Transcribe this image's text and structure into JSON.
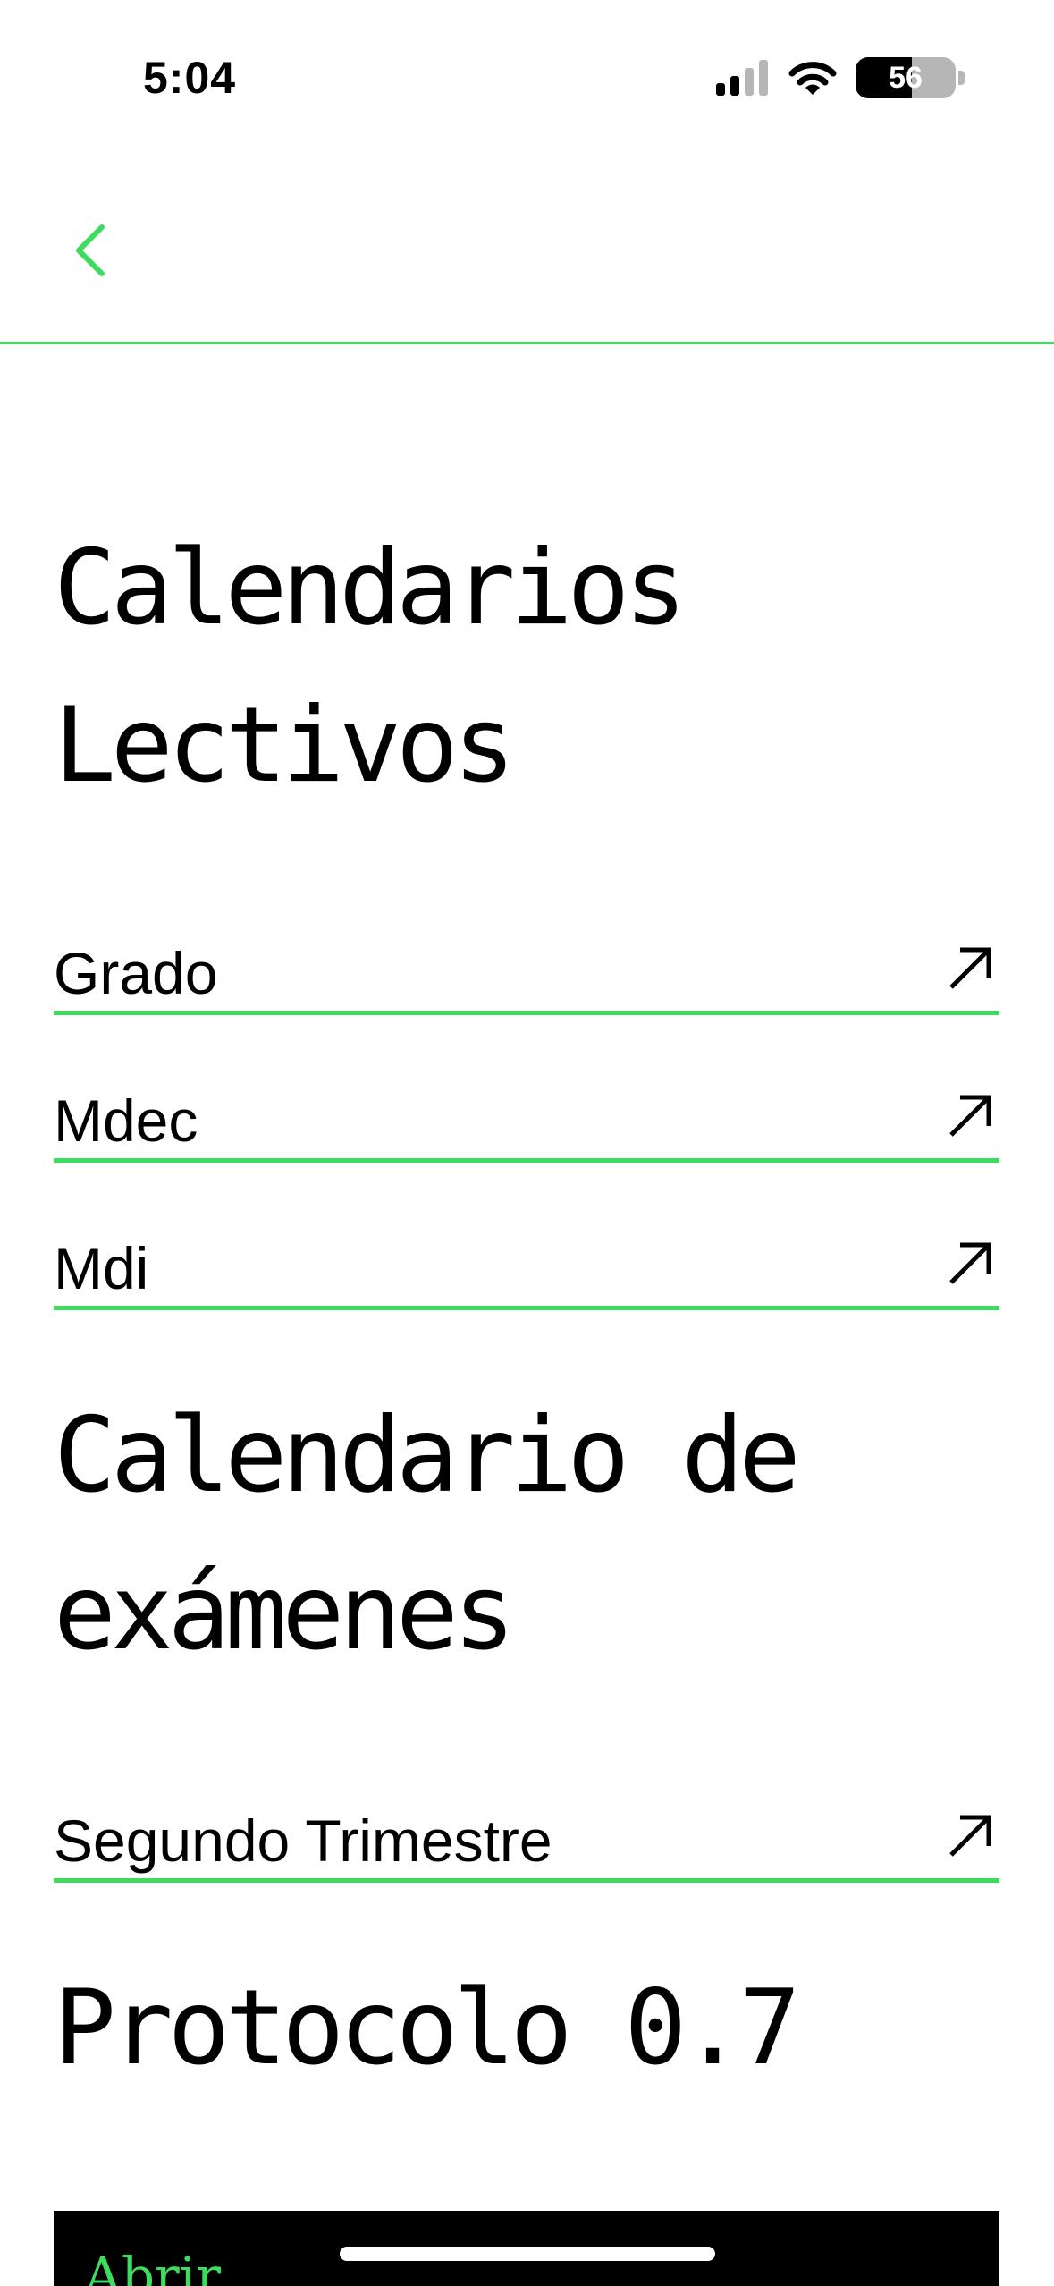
{
  "status_bar": {
    "time": "5:04",
    "battery_level": "56",
    "battery_fraction": 0.56
  },
  "colors": {
    "accent": "#3ddc5e",
    "text": "#000000",
    "background": "#ffffff",
    "dark_panel": "#000000"
  },
  "nav": {
    "back_icon": "chevron-left-icon"
  },
  "sections": {
    "lectivos": {
      "title_line1": "Calendarios",
      "title_line2": "Lectivos",
      "items": [
        {
          "label": "Grado",
          "icon": "arrow-up-right-icon"
        },
        {
          "label": "Mdec",
          "icon": "arrow-up-right-icon"
        },
        {
          "label": "Mdi",
          "icon": "arrow-up-right-icon"
        }
      ]
    },
    "examenes": {
      "title_line1": "Calendario de",
      "title_line2": "exámenes",
      "items": [
        {
          "label": "Segundo Trimestre",
          "icon": "arrow-up-right-icon"
        }
      ]
    },
    "protocolo": {
      "title": "Protocolo 0.7",
      "open_label": "Abrir"
    }
  }
}
